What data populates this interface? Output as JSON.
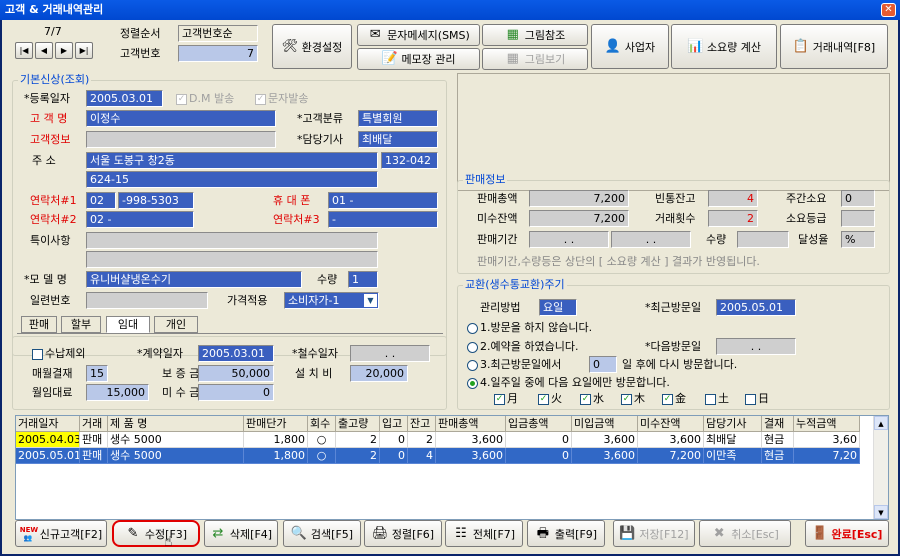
{
  "window": {
    "title": "고객 & 거래내역관리",
    "close": "✕"
  },
  "nav": {
    "counter": "7/7",
    "first": "|◀",
    "prev": "◀",
    "next": "▶",
    "last": "▶|",
    "sort_label": "정렬순서",
    "sort_value": "고객번호순",
    "custno_label": "고객번호",
    "custno_value": "7"
  },
  "toolbar": {
    "env": "환경설정",
    "sms": "문자메세지(SMS)",
    "memo": "메모장 관리",
    "picref": "그림참조",
    "picview": "그림보기",
    "business": "사업자",
    "usage": "소요량 계산",
    "trade": "거래내역[F8]"
  },
  "basic": {
    "title": "기본신상(조회)",
    "reg_label": "*등록일자",
    "reg_value": "2005.03.01",
    "dm": "D.M 발송",
    "sms_send": "문자발송",
    "name_label": "고 객 명",
    "name_value": "이정수",
    "info_label": "고객정보",
    "class_label": "*고객분류",
    "class_value": "특별회원",
    "tech_label": "*담당기사",
    "tech_value": "최배달",
    "addr_label": "주   소",
    "addr1": "서울 도봉구 창2동",
    "zip": "132-042",
    "addr2": "624-15",
    "tel1_label": "연락처#1",
    "tel1_a": "02",
    "tel1_b": "-998-5303",
    "mobile_label": "휴 대 폰",
    "mobile_value": "01 -",
    "tel2_label": "연락처#2",
    "tel2_value": "02  -",
    "tel3_label": "연락처#3",
    "tel3_value": "-",
    "note_label": "특이사항",
    "model_label": "*모 델 명",
    "model_value": "유니버샬냉온수기",
    "qty_label": "수량",
    "qty_value": "1",
    "serial_label": "일련번호",
    "price_label": "가격적용",
    "price_value": "소비자가-1"
  },
  "tabs": [
    "판매",
    "할부",
    "임대",
    "개인"
  ],
  "rental": {
    "exclude": "수납제외",
    "contract_label": "*계약일자",
    "contract_value": "2005.03.01",
    "remove_label": "*철수일자",
    "remove_value": ". .",
    "monthly_label": "매월결재",
    "monthly_value": "15 일",
    "deposit_label": "보 증 금",
    "deposit_value": "50,000",
    "install_label": "설 치 비",
    "install_value": "20,000",
    "fee_label": "월임대료",
    "fee_value": "15,000",
    "unpaid_label": "미 수 금",
    "unpaid_value": "0"
  },
  "sales": {
    "title": "판매정보",
    "total_label": "판매총액",
    "total_value": "7,200",
    "empty_label": "빈통잔고",
    "empty_value": "4",
    "weekly_label": "주간소요",
    "weekly_value": "0",
    "unpaid_label": "미수잔액",
    "unpaid_value": "7,200",
    "count_label": "거래횟수",
    "count_value": "2",
    "grade_label": "소요등급",
    "grade_value": "",
    "period_label": "판매기간",
    "period_from": ". .",
    "period_to": ". .",
    "qty_label": "수량",
    "rate_label": "달성율",
    "rate_value": "%",
    "note": "판매기간,수량등은 상단의 [ 소요량 계산 ] 결과가 반영됩니다."
  },
  "exchange": {
    "title": "교환(생수통교환)주기",
    "method_label": "관리방법",
    "method_value": "요일",
    "last_label": "*최근방문일",
    "last_value": "2005.05.01",
    "opt1": "1.방문을 하지 않습니다.",
    "opt2": "2.예약을 하였습니다.",
    "next_label": "*다음방문일",
    "next_value": ". .",
    "opt3a": "3.최근방문일에서",
    "opt3_days": "0",
    "opt3b": "일 후에 다시 방문합니다.",
    "opt4": "4.일주일 중에 다음 요일에만 방문합니다.",
    "days": [
      {
        "label": "月",
        "checked": true
      },
      {
        "label": "火",
        "checked": true
      },
      {
        "label": "水",
        "checked": true
      },
      {
        "label": "木",
        "checked": true
      },
      {
        "label": "金",
        "checked": true
      },
      {
        "label": "土",
        "checked": false
      },
      {
        "label": "日",
        "checked": false
      }
    ]
  },
  "table": {
    "headers": [
      "거래일자",
      "거래",
      "제 품 명",
      "판매단가",
      "회수",
      "출고량",
      "입고",
      "잔고",
      "판매총액",
      "입금총액",
      "미입금액",
      "미수잔액",
      "담당기사",
      "결재",
      "누적금액"
    ],
    "rows": [
      [
        "2005.04.03",
        "판매",
        "생수 5000",
        "1,800",
        "○",
        "2",
        "0",
        "2",
        "3,600",
        "0",
        "3,600",
        "3,600",
        "최배달",
        "현금",
        "3,60"
      ],
      [
        "2005.05.01",
        "판매",
        "생수 5000",
        "1,800",
        "○",
        "2",
        "0",
        "4",
        "3,600",
        "0",
        "3,600",
        "7,200",
        "이만족",
        "현금",
        "7,20"
      ]
    ]
  },
  "bottom": {
    "new_badge": "NEW",
    "new": "신규고객[F2]",
    "edit": "수정[F3]",
    "del": "삭제[F4]",
    "search": "검색[F5]",
    "sort": "정렬[F6]",
    "all": "전체[F7]",
    "print": "출력[F9]",
    "save": "저장[F12]",
    "cancel": "취소[Esc]",
    "done": "완료[Esc]"
  }
}
